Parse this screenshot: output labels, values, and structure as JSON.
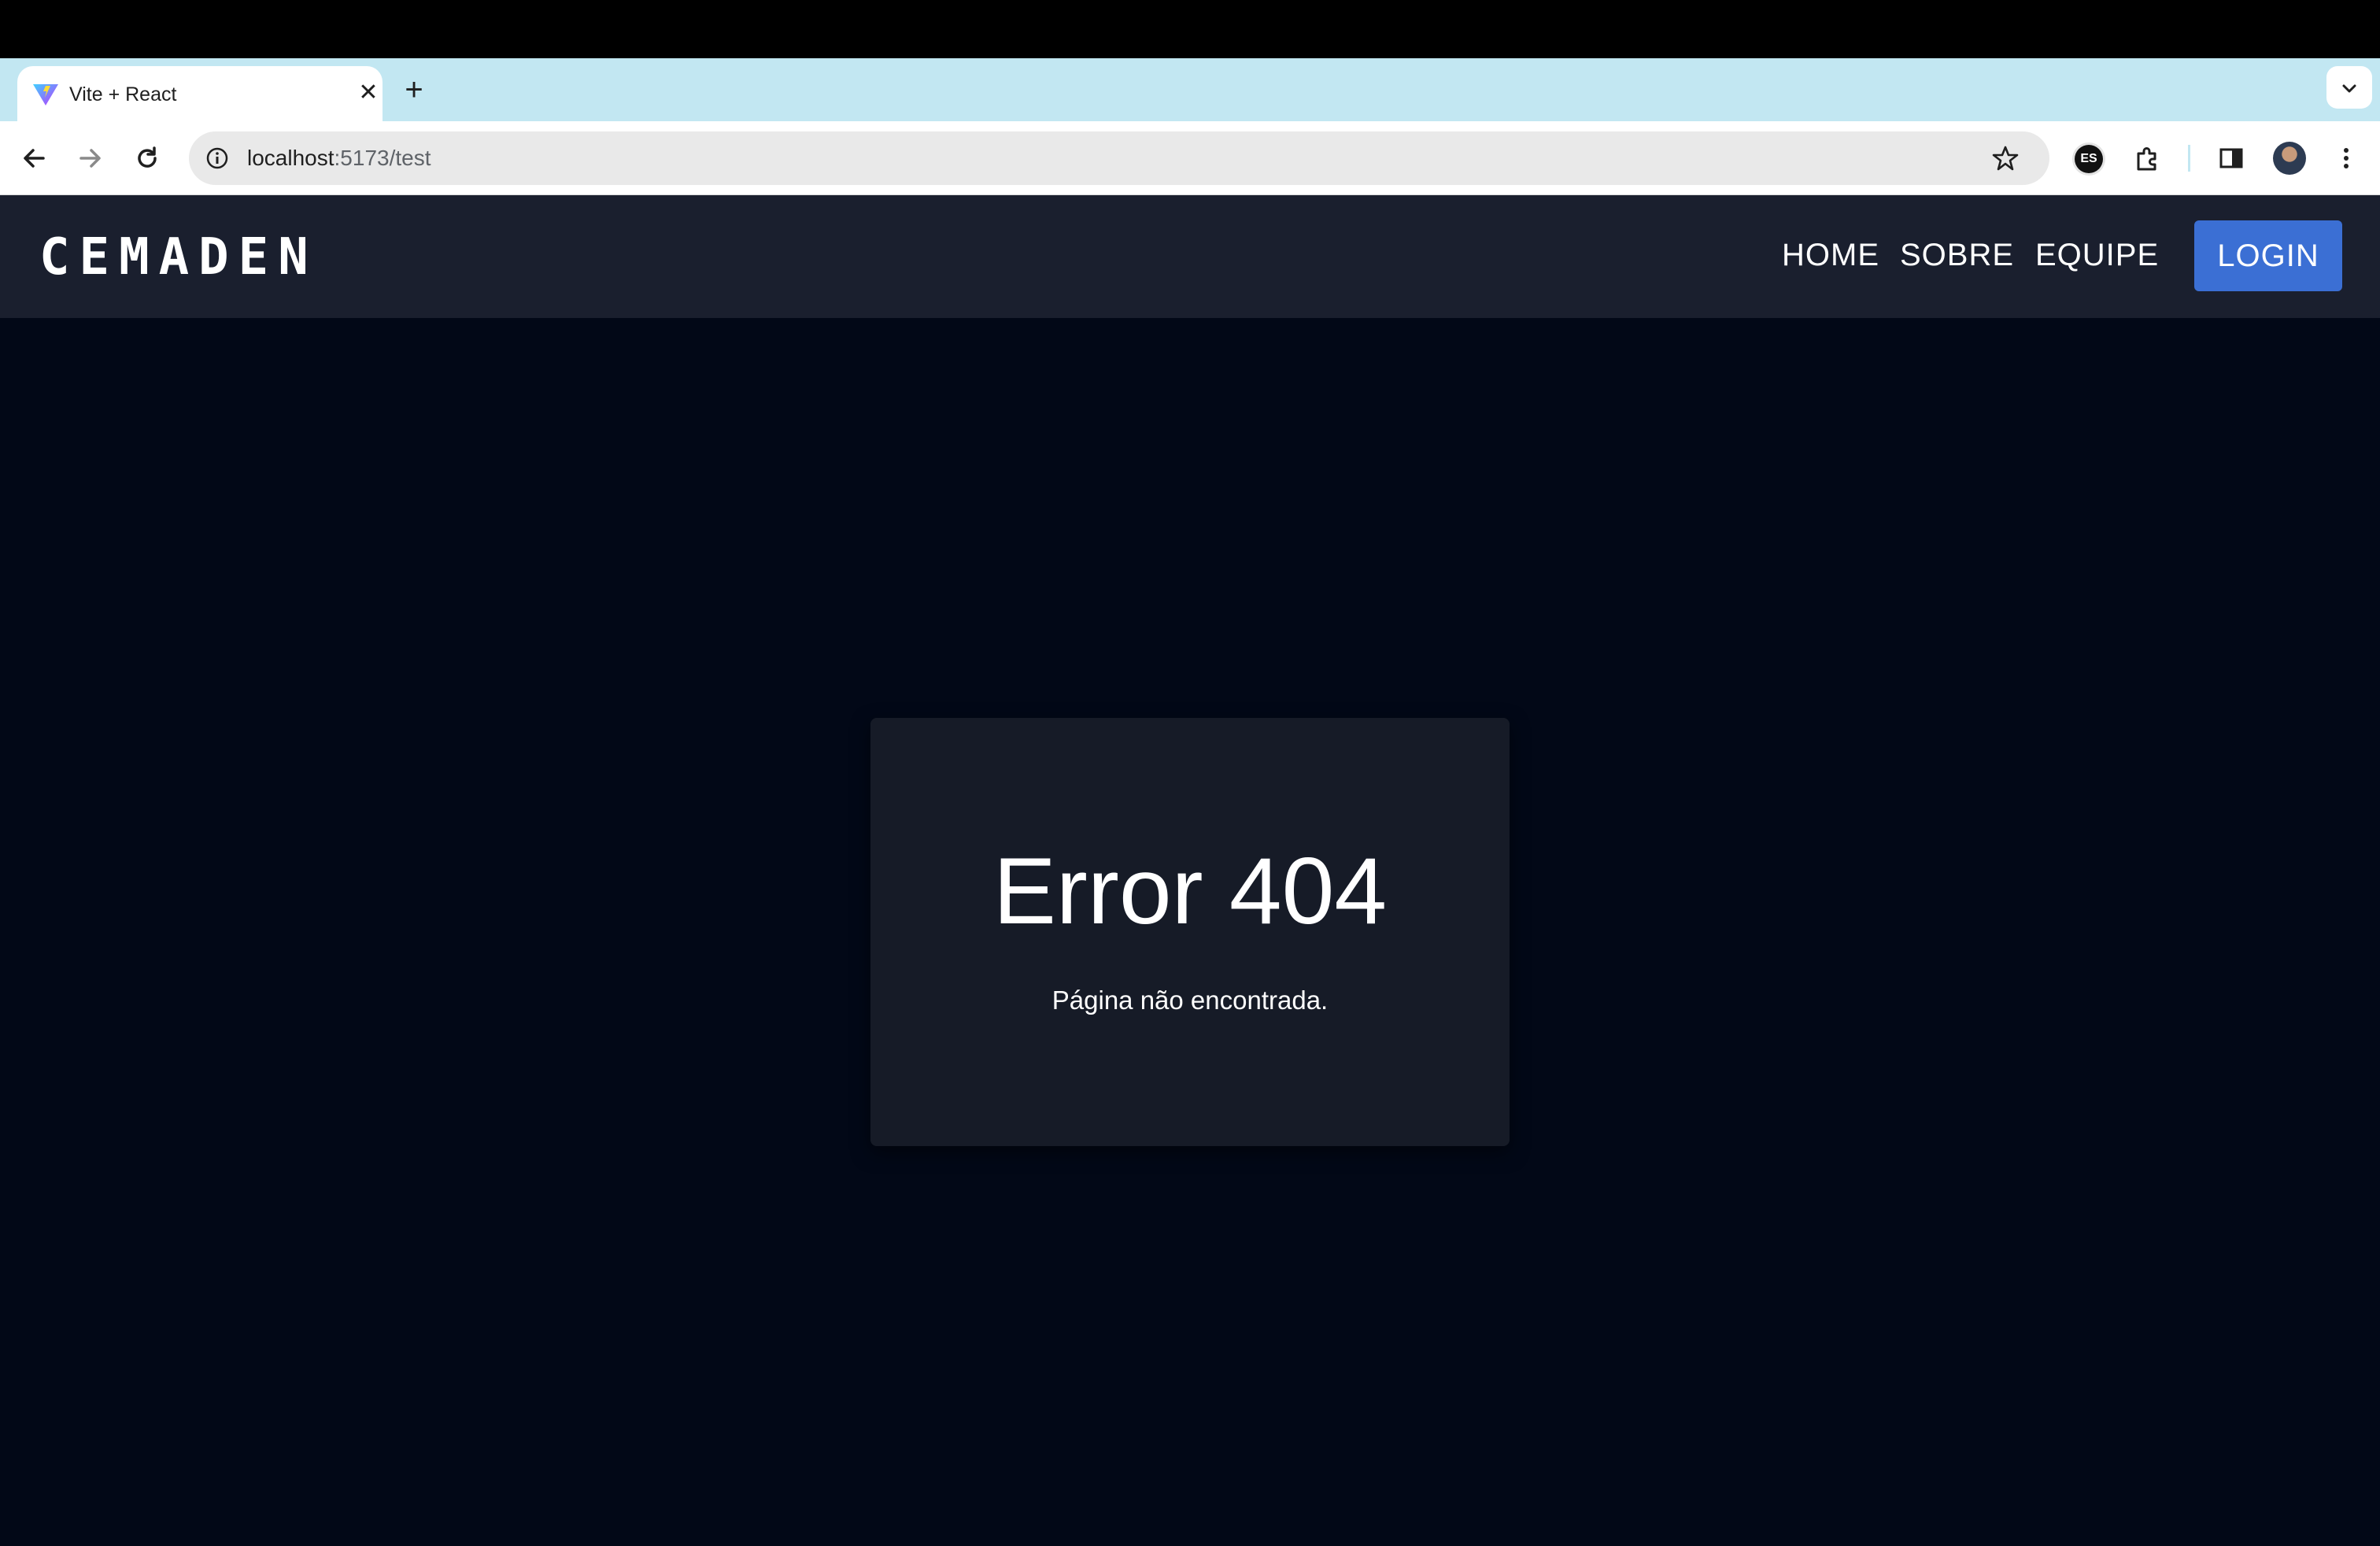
{
  "browser": {
    "tab": {
      "title": "Vite + React",
      "close_glyph": "✕",
      "favicon": "vite-logo-icon"
    },
    "new_tab_glyph": "+",
    "tab_search_glyph": "⌄",
    "url_host": "localhost",
    "url_path": ":5173/test",
    "extension_badge": "ES",
    "icons": [
      "back-icon",
      "forward-icon",
      "reload-icon",
      "site-info-icon",
      "bookmark-star-icon",
      "extensions-icon",
      "side-panel-icon",
      "profile-avatar",
      "menu-dots-icon"
    ]
  },
  "header": {
    "brand": "CEMADEN",
    "nav": [
      "HOME",
      "SOBRE",
      "EQUIPE"
    ],
    "login": "LOGIN"
  },
  "error": {
    "title": "Error 404",
    "message": "Página não encontrada."
  },
  "colors": {
    "page_bg": "#020817",
    "header_bg": "#1a1f2e",
    "card_bg": "#161b27",
    "login_bg": "#3b6fd4",
    "tabstrip_bg": "#c2e7f2"
  }
}
